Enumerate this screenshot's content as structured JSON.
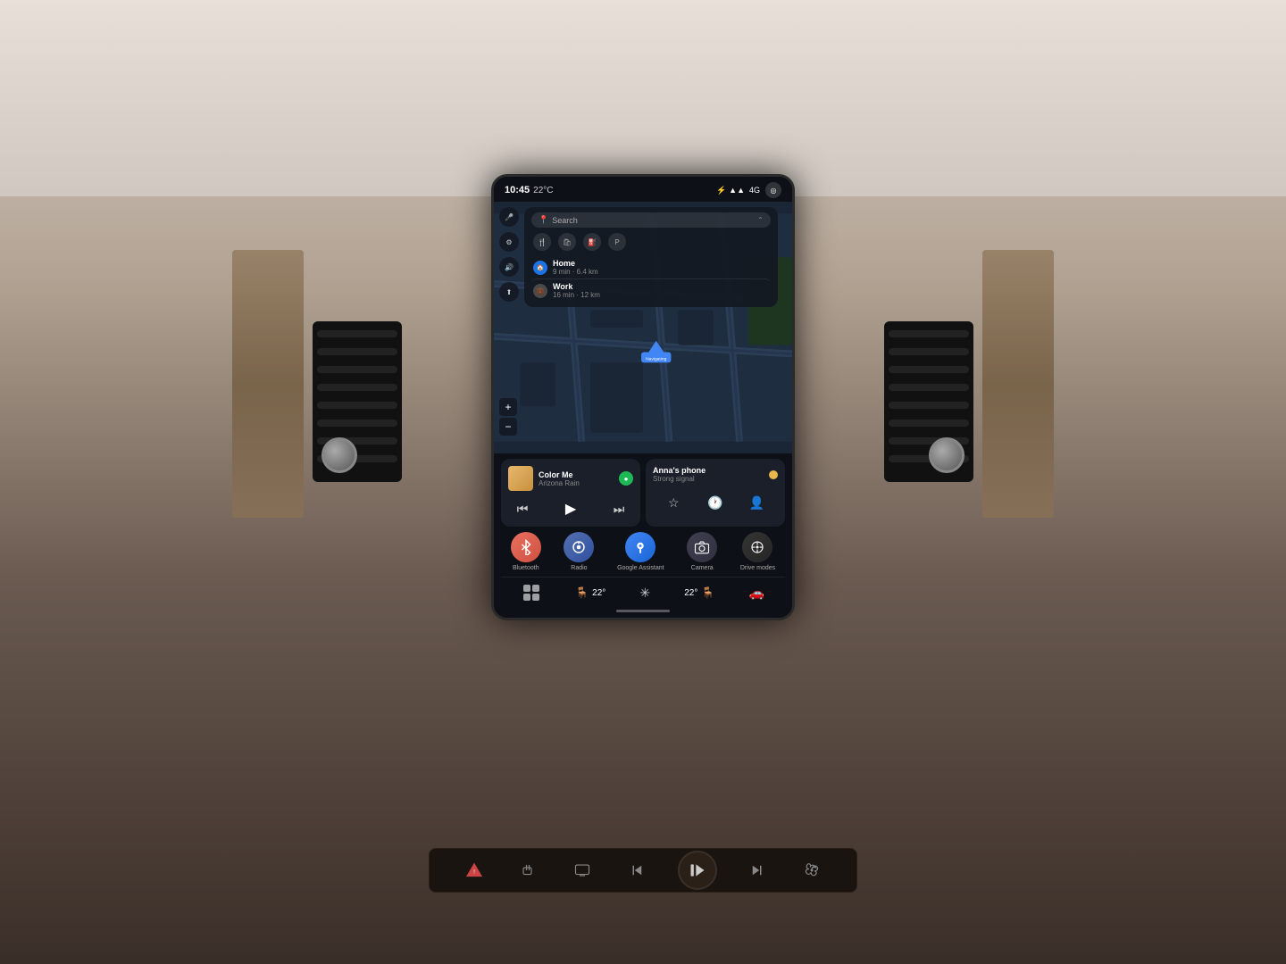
{
  "car": {
    "background_color": "#c4b4a4"
  },
  "screen": {
    "status_bar": {
      "time": "10:45",
      "temperature": "22°C",
      "bluetooth_icon": "bluetooth",
      "wifi_icon": "wifi",
      "signal_icon": "signal",
      "network": "4G"
    },
    "navigation": {
      "search_placeholder": "Search",
      "categories": [
        "restaurant",
        "shopping",
        "gas",
        "parking"
      ],
      "destinations": [
        {
          "name": "Home",
          "time": "9 min",
          "distance": "6.4 km",
          "icon": "home"
        },
        {
          "name": "Work",
          "time": "16 min",
          "distance": "12 km",
          "icon": "work"
        }
      ],
      "nav_label": "Navigating",
      "zoom_plus": "+",
      "zoom_minus": "−"
    },
    "media": {
      "song_title": "Color Me",
      "artist": "Arizona Rain",
      "service": "Spotify",
      "controls": {
        "prev": "⏮",
        "play": "▶",
        "next": "⏭"
      }
    },
    "phone": {
      "name": "Anna's phone",
      "signal_status": "Strong signal",
      "actions": {
        "favorites": "☆",
        "recents": "🕐",
        "contacts": "👤"
      }
    },
    "apps": [
      {
        "id": "bluetooth",
        "label": "Bluetooth",
        "icon": "⬡",
        "bg_color": "#e87060"
      },
      {
        "id": "radio",
        "label": "Radio",
        "icon": "◉",
        "bg_color": "#6080c0"
      },
      {
        "id": "google-assistant",
        "label": "Google Assistant",
        "icon": "◎",
        "bg_color": "#4285f4"
      },
      {
        "id": "camera",
        "label": "Camera",
        "icon": "⬛",
        "bg_color": "#404040"
      },
      {
        "id": "drive-modes",
        "label": "Drive modes",
        "icon": "◎",
        "bg_color": "#303030"
      }
    ],
    "climate": {
      "driver_temp": "22°",
      "fan_speed": "",
      "passenger_temp": "22°",
      "driver_icon": "🪑",
      "fan_icon": "❄",
      "passenger_icon": "🪑",
      "car_icon": "🚗"
    }
  },
  "physical_controls": {
    "hazard": "⚠",
    "seat_heat": "◻",
    "screen_icon": "▭",
    "prev_track": "⏮",
    "play_pause": "⏯",
    "next_track": "⏭",
    "fan_icon": "≈"
  }
}
